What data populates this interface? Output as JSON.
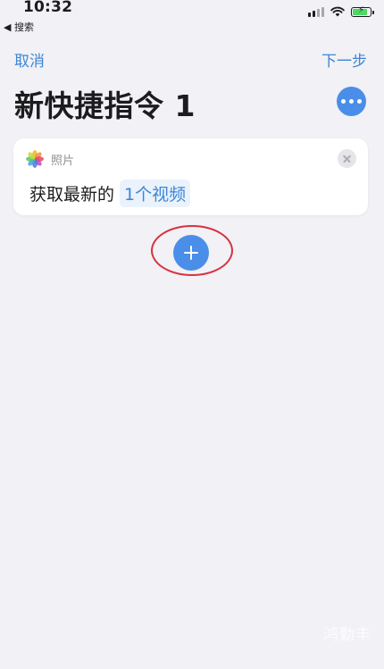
{
  "status_bar": {
    "time": "10:32",
    "back_to_app": "◀ 搜索",
    "battery_level": 0.85,
    "icons": [
      "signal-icon",
      "wifi-icon",
      "battery-icon"
    ]
  },
  "nav": {
    "cancel_label": "取消",
    "next_label": "下一步"
  },
  "page": {
    "title": "新快捷指令 1",
    "more_icon": "ellipsis-icon"
  },
  "action_card": {
    "app_name": "照片",
    "app_icon": "photos-icon",
    "action_text": "获取最新的",
    "parameter": "1个视频",
    "close_icon": "close-icon"
  },
  "add_action": {
    "icon": "plus-icon"
  },
  "watermark": "鸿勤丰",
  "colors": {
    "accent": "#3d86d6",
    "button_fill": "#4a8ee9",
    "background": "#f1f1f6",
    "annotation_ring": "#d8313f"
  }
}
